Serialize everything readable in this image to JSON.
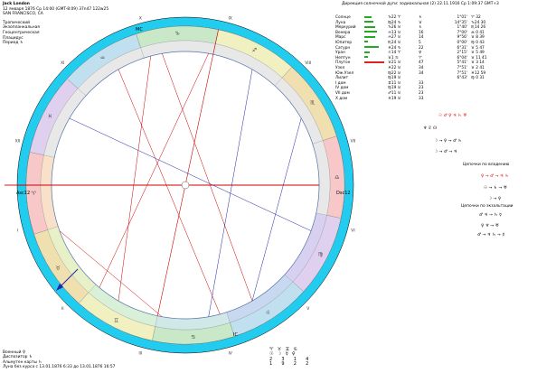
{
  "header": {
    "name": "Jack London",
    "datetime": "12 января 1876  Ср  14:00 (GMT-8:09) 37n47  122w25",
    "place": "SAN FRANCISCO, CA",
    "zodiac": "Тропический",
    "houses": "Экзопланкальная",
    "center": "Геоцентрическая",
    "system": "Плацидус",
    "period_label": "Период",
    "period_glyph": "♄"
  },
  "direction_title": "Дирекция солнечной дуги: зодиакальная (2)  22.11.1916  Ср  1:09:37 GMT+3",
  "table_header": [
    "",
    "",
    "",
    "R",
    "E",
    "D",
    "F",
    "",
    "Ψ",
    "",
    "R",
    ""
  ],
  "planets": [
    {
      "name": "Солнце",
      "pos": "♑22 ♈",
      "e": "♄",
      "dir": "1°01'",
      "dg": "♈ 32",
      "bar": 8,
      "bc": "#2a2"
    },
    {
      "name": "Луна",
      "pos": "♍24 ♑",
      "e": "♉",
      "dir": "14°35'",
      "dg": "♑24 30",
      "bar": 10,
      "bc": "#2a2"
    },
    {
      "name": "Меркурий",
      "pos": "♑26 ♉",
      "e": "♄",
      "dir": "1°40'",
      "dg": "♏14 26",
      "bar": 12,
      "bc": "#2a2"
    },
    {
      "name": "Венера",
      "pos": "♒13 ♉",
      "e": "16",
      "dir": "7°00'",
      "dg": "♎ 0 41",
      "bar": 14,
      "bc": "#2a2"
    },
    {
      "name": "Марс",
      "pos": "♒27 ♉",
      "e": "14",
      "dir": "9°56'",
      "dg": "♉ 8 39",
      "bar": 12,
      "bc": "#2a2"
    },
    {
      "name": "Юпитер",
      "pos": "♏24 ♉",
      "e": "5",
      "dir": "0°00'",
      "dg": "♍ 0 43",
      "bar": 4,
      "bc": "#2a2"
    },
    {
      "name": "Сатурн",
      "pos": "♓24 ♑",
      "e": "22",
      "dir": "6°31'",
      "dg": "♉ 5 47",
      "bar": 16,
      "bc": "#2a2"
    },
    {
      "name": "Уран",
      "pos": "♌14 ♈",
      "e": "♀",
      "dir": "2°15'",
      "dg": "♉ 5 49",
      "bar": 6,
      "bc": "#2a2"
    },
    {
      "name": "Нептун",
      "pos": "♉1 ♋",
      "e": "♈",
      "dir": "6°04'",
      "dg": "♉ 11 41",
      "bar": 4,
      "bc": "#2a2"
    },
    {
      "name": "Плутон",
      "pos": "♉21 ♉",
      "e": "47",
      "dir": "5°41'",
      "dg": "♉ 3 14",
      "bar": 22,
      "bc": "#d22"
    },
    {
      "name": "Узел",
      "pos": "♓22 ♉",
      "e": "34",
      "dir": "7°51'",
      "dg": "♉ 2 41",
      "bar": 0,
      "bc": "#2a2"
    },
    {
      "name": "Юж.Узел",
      "pos": "♍22 ♉",
      "e": "34",
      "dir": "7°51'",
      "dg": "♓12 59",
      "bar": 0,
      "bc": "#2a2"
    },
    {
      "name": "Лилит",
      "pos": "♍19 ♉",
      "e": "",
      "dir": "6°43'",
      "dg": "♍ 0 31",
      "bar": 0,
      "bc": "#2a2"
    },
    {
      "name": "I дом",
      "pos": "♊11 ♉",
      "e": "33",
      "dir": "",
      "dg": "",
      "bar": 0,
      "bc": "#2a2"
    },
    {
      "name": "IV дом",
      "pos": "♍19 ♉",
      "e": "23",
      "dir": "",
      "dg": "",
      "bar": 0,
      "bc": "#2a2"
    },
    {
      "name": "VII дом",
      "pos": "♐11 ♉",
      "e": "23",
      "dir": "",
      "dg": "",
      "bar": 0,
      "bc": "#2a2"
    },
    {
      "name": "X дом",
      "pos": "♓19 ♉",
      "e": "33",
      "dir": "",
      "dg": "",
      "bar": 0,
      "bc": "#2a2"
    }
  ],
  "right_panel": {
    "chain1": "☉ ♂ ♀ ♃ ♄ ♅",
    "chain2": "♆ ♇ ☊",
    "chain3": "☽ → ♀ → ♂ ♄",
    "chain4": "☽ → ♂ → ♃",
    "dispositor_title": "Цепочки по владению",
    "chain5": "♀ → ♂ → ♃ ♄",
    "chain6": "☉ → ♄ → ♅",
    "chain7": "☽ → ♀",
    "exalt_title": "Цепочки по экзальтации",
    "chain8": "♂ ♃ → ♄ ☿",
    "chain9": "♀ ♆ → ♅",
    "chain10": "♂ → ♃ ♄ → ☿"
  },
  "bottom": {
    "ruler": "Военный ♀",
    "dispositor": "Диспозитор ♄",
    "almuten": "Альмутен карты ♄",
    "moon": "Луна без курса с 13.01.1876  6:33 до 13.01.1876 16:57"
  },
  "elements": {
    "row1": "♈♉♊♋",
    "row2": "☉☽☿♀",
    "row3": "2 3 1 4",
    "row4": "1 9 2 2"
  },
  "wheel": {
    "asc_label": "Asc",
    "asc_deg": "12",
    "dsc_label": "Dsc",
    "dsc_deg": "12",
    "mc_label": "MC",
    "ic_label": "IC",
    "houses": [
      "I",
      "II",
      "III",
      "IV",
      "V",
      "VI",
      "VII",
      "VIII",
      "IX",
      "X",
      "XI",
      "XII"
    ],
    "outer_color": "#22ccee",
    "signs": [
      "♈",
      "♉",
      "♊",
      "♋",
      "♌",
      "♍",
      "♎",
      "♏",
      "♐",
      "♑",
      "♒",
      "♓"
    ]
  }
}
